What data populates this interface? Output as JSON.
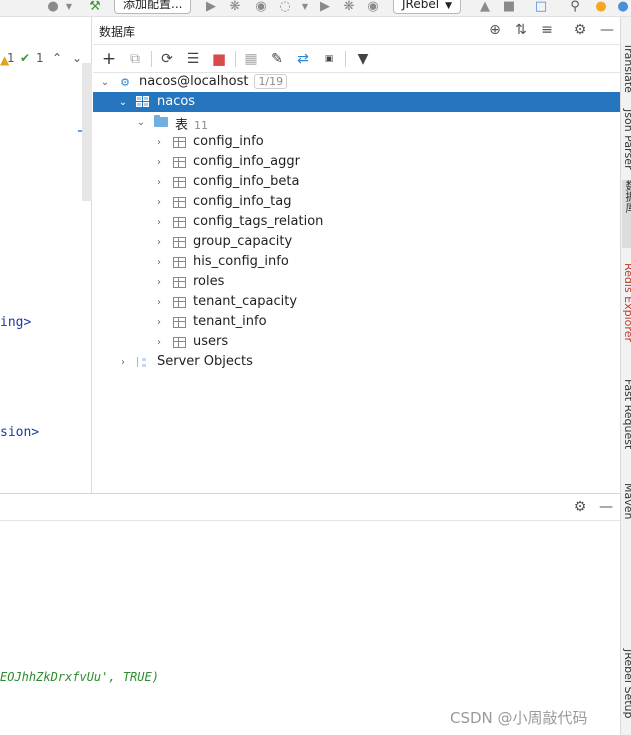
{
  "toolbar": {
    "add_config_label": "添加配置...",
    "jrebel_label": "JRebel"
  },
  "editor": {
    "warnings_count": "1",
    "checks_count": "1",
    "code_line_1": "ing>",
    "code_line_2": "sion>"
  },
  "database_panel": {
    "title": "数据库",
    "tree": {
      "connection": {
        "label": "nacos@localhost",
        "badge": "1/19"
      },
      "schema": {
        "label": "nacos"
      },
      "tables_folder": {
        "label": "表",
        "count": "11"
      },
      "tables": [
        {
          "label": "config_info"
        },
        {
          "label": "config_info_aggr"
        },
        {
          "label": "config_info_beta"
        },
        {
          "label": "config_info_tag"
        },
        {
          "label": "config_tags_relation"
        },
        {
          "label": "group_capacity"
        },
        {
          "label": "his_config_info"
        },
        {
          "label": "roles"
        },
        {
          "label": "tenant_capacity"
        },
        {
          "label": "tenant_info"
        },
        {
          "label": "users"
        }
      ],
      "server_objects": {
        "label": "Server Objects"
      }
    }
  },
  "right_tool_strip": {
    "tabs": [
      {
        "label": "Translate"
      },
      {
        "label": "Json Parser"
      },
      {
        "label": "数据库"
      },
      {
        "label": "Redis Explorer"
      },
      {
        "label": "Fast Request"
      },
      {
        "label": "Maven"
      },
      {
        "label": "JRebel Setup"
      }
    ]
  },
  "bottom_panel": {
    "code_text_green": "EOJhhZkDrxfvUu', TRUE)"
  },
  "watermark": "CSDN @小周敲代码",
  "colors": {
    "selection": "#2675bf",
    "folder": "#6fb0e0",
    "code_tag": "#1a3aa8",
    "code_string": "#2e8b2e"
  },
  "icons": {
    "add": "plus-icon",
    "refresh": "refresh-icon",
    "stop": "stop-icon",
    "filter": "filter-icon",
    "settings": "gear-icon",
    "table": "table-icon",
    "folder": "folder-icon"
  }
}
